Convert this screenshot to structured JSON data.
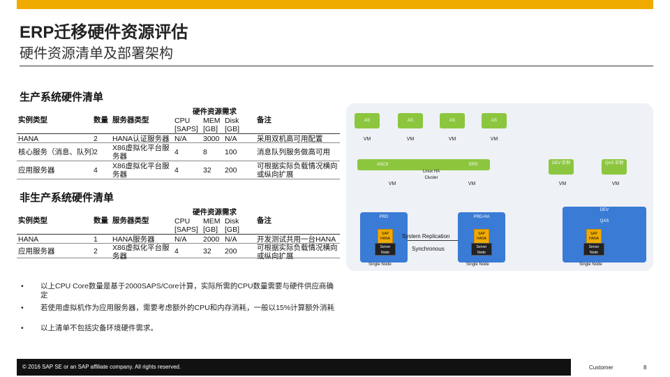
{
  "header": {
    "title": "ERP迁移硬件资源评估",
    "subtitle": "硬件资源清单及部署架构"
  },
  "prod": {
    "section_title": "生产系统硬件清单",
    "col_instance": "实例类型",
    "col_count": "数量",
    "col_server": "服务器类型",
    "col_req": "硬件资源需求",
    "col_cpu": "CPU",
    "col_mem": "MEM",
    "col_disk": "Disk",
    "col_cpu_unit": "[SAPS]",
    "col_mem_unit": "[GB]",
    "col_disk_unit": "[GB]",
    "col_note": "备注",
    "rows": [
      {
        "instance": "HANA",
        "count": "2",
        "server": "HANA认证服务器",
        "cpu": "N/A",
        "mem": "3000",
        "disk": "N/A",
        "note": "采用双机高可用配置"
      },
      {
        "instance": "核心服务（消息、队列）",
        "count": "2",
        "server": "X86虚拟化平台服务器",
        "cpu": "4",
        "mem": "8",
        "disk": "100",
        "note": "消息队列服务做高可用"
      },
      {
        "instance": "应用服务器",
        "count": "4",
        "server": "X86虚拟化平台服务器",
        "cpu": "4",
        "mem": "32",
        "disk": "200",
        "note": "可根据实际负载情况横向或纵向扩展"
      }
    ]
  },
  "nonprod": {
    "section_title": "非生产系统硬件清单",
    "col_instance": "实例类型",
    "col_count": "数量",
    "col_server": "服务器类型",
    "col_req": "硬件资源需求",
    "col_cpu": "CPU",
    "col_mem": "MEM",
    "col_disk": "Disk",
    "col_cpu_unit": "[SAPS]",
    "col_mem_unit": "[GB]",
    "col_disk_unit": "[GB]",
    "col_note": "备注",
    "rows": [
      {
        "instance": "HANA",
        "count": "1",
        "server": "HANA服务器",
        "cpu": "N/A",
        "mem": "2000",
        "disk": "N/A",
        "note": "开发测试共用一台HANA"
      },
      {
        "instance": "应用服务器",
        "count": "2",
        "server": "X86虚拟化平台服务器",
        "cpu": "4",
        "mem": "32",
        "disk": "200",
        "note": "可根据实际负载情况横向或纵向扩展"
      }
    ]
  },
  "notes": {
    "bullet_char": "•",
    "items": [
      "以上CPU Core数量是基于2000SAPS/Core计算，实际所需的CPU数量需要与硬件供应商确定",
      "若使用虚拟机作为应用服务器，需要考虑额外的CPU和内存消耗，一般以15%计算额外消耗",
      "以上清单不包括灾备环境硬件需求。"
    ]
  },
  "diagram": {
    "as_label": "AS",
    "vm_label": "VM",
    "ascs_label": "ASCS",
    "ers_label": "ERS",
    "cluster_label": "Linux HA Cluster",
    "dev_label": "DEV 实例",
    "qas_label": "QAS 实例",
    "prd_label": "PRD",
    "prd_ha_label": "PRD-HA",
    "dev_box_label": "DEV",
    "qas_box_label": "QAS",
    "sap_hana_label": "SAP HANA",
    "server_node_label": "Server Node",
    "single_node_label": "Single Node",
    "replication_label": "System Replication",
    "synchronous_label": "Synchronous",
    "colors": {
      "green": "#8cc63f",
      "blue": "#3a7bd5",
      "gold": "#f0ab00"
    }
  },
  "footer": {
    "copyright": "© 2016 SAP SE or an SAP affiliate company. All rights reserved.",
    "audience": "Customer",
    "page": "8"
  }
}
